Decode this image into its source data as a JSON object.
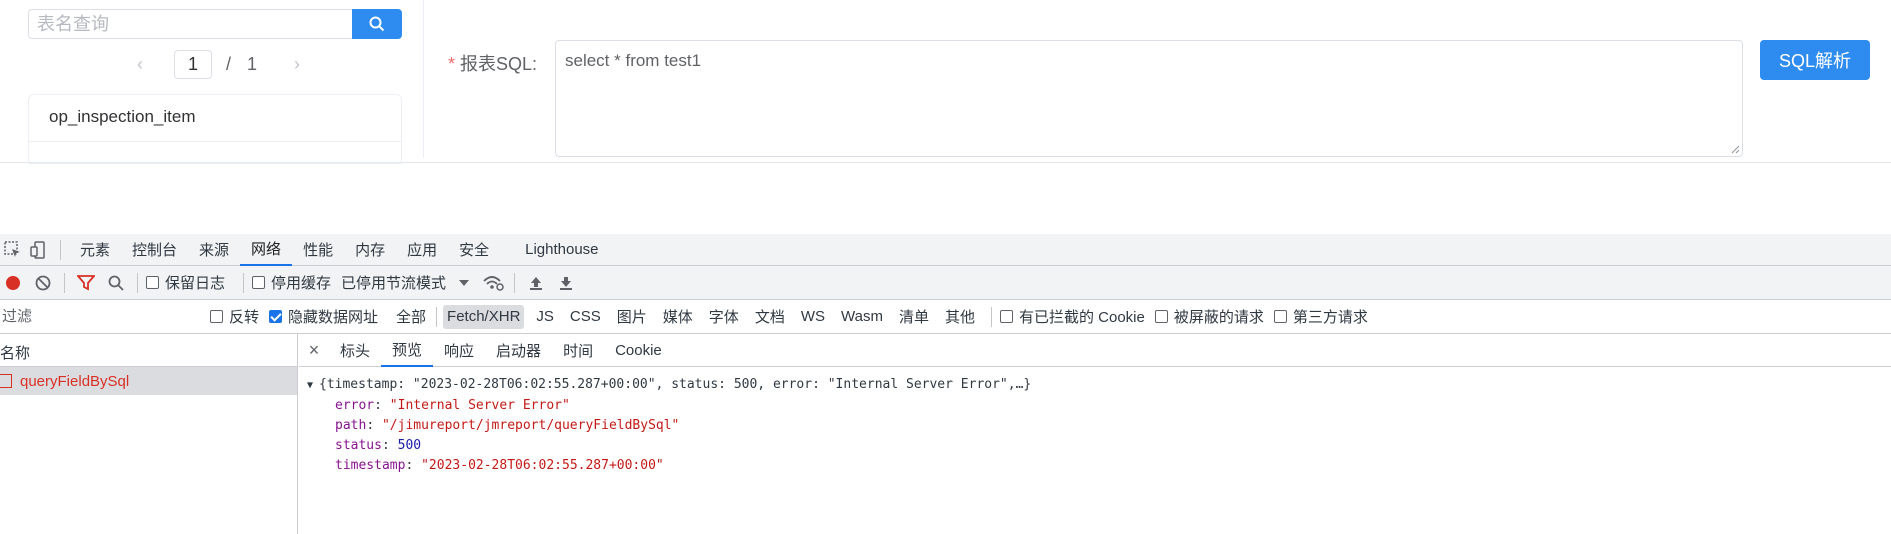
{
  "app": {
    "search": {
      "placeholder": "表名查询"
    },
    "pager": {
      "prev": "‹",
      "current": "1",
      "separator": "/",
      "total": "1",
      "next": "›"
    },
    "table_list": [
      "op_inspection_item"
    ],
    "sql": {
      "required_mark": "*",
      "label": "报表SQL:",
      "value": "select *  from test1"
    },
    "parse_button": "SQL解析",
    "accent_color": "#2e8cf0"
  },
  "devtools": {
    "tabs": [
      "元素",
      "控制台",
      "来源",
      "网络",
      "性能",
      "内存",
      "应用",
      "安全",
      "Lighthouse"
    ],
    "active_tab": "网络",
    "toolbar": {
      "preserve_log": "保留日志",
      "disable_cache": "停用缓存",
      "throttle": "已停用节流模式"
    },
    "filter": {
      "placeholder": "过滤",
      "invert": "反转",
      "hide_data_urls": "隐藏数据网址",
      "types": [
        "全部",
        "Fetch/XHR",
        "JS",
        "CSS",
        "图片",
        "媒体",
        "字体",
        "文档",
        "WS",
        "Wasm",
        "清单",
        "其他"
      ],
      "active_type": "Fetch/XHR",
      "blocked_cookies": "有已拦截的 Cookie",
      "blocked_requests": "被屏蔽的请求",
      "third_party": "第三方请求"
    },
    "name_header": "名称",
    "requests": [
      "queryFieldBySql"
    ],
    "detail_tabs": [
      "标头",
      "预览",
      "响应",
      "启动器",
      "时间",
      "Cookie"
    ],
    "active_detail_tab": "预览",
    "close_glyph": "×",
    "preview": {
      "summary": "{timestamp: \"2023-02-28T06:02:55.287+00:00\", status: 500, error: \"Internal Server Error\",…}",
      "fields": [
        {
          "key": "error",
          "value": "\"Internal Server Error\"",
          "kind": "str"
        },
        {
          "key": "path",
          "value": "\"/jimureport/jmreport/queryFieldBySql\"",
          "kind": "str"
        },
        {
          "key": "status",
          "value": "500",
          "kind": "num"
        },
        {
          "key": "timestamp",
          "value": "\"2023-02-28T06:02:55.287+00:00\"",
          "kind": "str"
        }
      ]
    }
  }
}
